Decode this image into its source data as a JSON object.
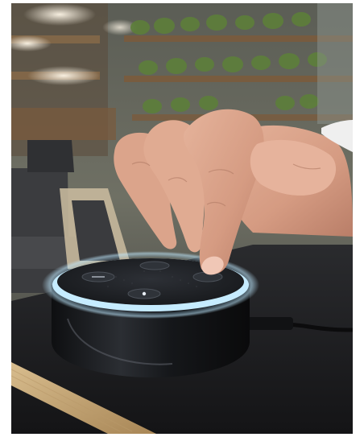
{
  "image": {
    "subject": "hand-pressing-smart-speaker",
    "colors": {
      "background_wall": "#6e6f63",
      "plants": "#5c7a3a",
      "table": "#1c1d20",
      "table_edge_wood": "#c7a978",
      "speaker_body": "#141518",
      "speaker_top": "#23262b",
      "light_ring": "#bfe9ff",
      "skin": "#d9a38c",
      "cable": "#0c0c0d"
    }
  }
}
